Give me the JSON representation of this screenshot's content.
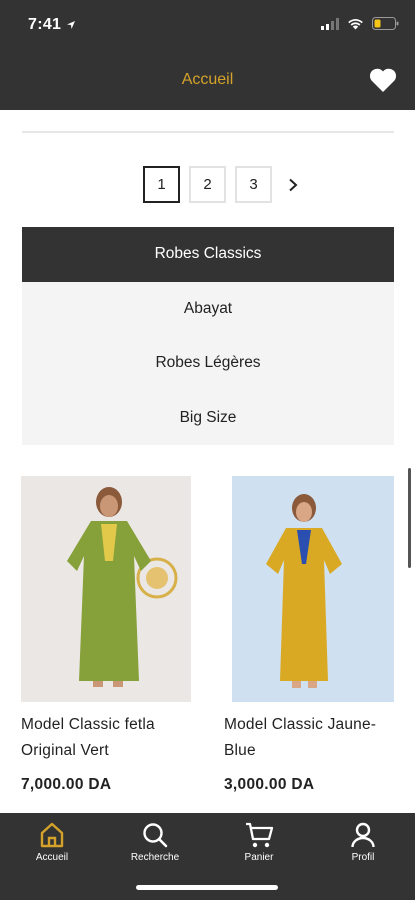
{
  "status_bar": {
    "time": "7:41"
  },
  "header": {
    "title": "Accueil",
    "favorites_icon": "heart-icon"
  },
  "pagination": {
    "pages": [
      "1",
      "2",
      "3"
    ],
    "current": "1",
    "next_icon": "chevron-right-icon"
  },
  "categories": [
    {
      "label": "Robes Classics",
      "active": true
    },
    {
      "label": "Abayat",
      "active": false
    },
    {
      "label": "Robes Légères",
      "active": false
    },
    {
      "label": "Big Size",
      "active": false
    }
  ],
  "products": [
    {
      "name": "Model Classic fetla Original Vert",
      "price": "7,000.00 DA",
      "image_bg": "#efeceb",
      "dress_color": "#86a03a"
    },
    {
      "name": "Model Classic Jaune-Blue",
      "price": "3,000.00 DA",
      "image_bg": "#cfe0f0",
      "dress_color": "#d9a923"
    }
  ],
  "tab_bar": {
    "accent": "#d4a22a",
    "tabs": [
      {
        "label": "Accueil",
        "icon": "home-icon",
        "active": true
      },
      {
        "label": "Recherche",
        "icon": "search-icon",
        "active": false
      },
      {
        "label": "Panier",
        "icon": "cart-icon",
        "active": false
      },
      {
        "label": "Profil",
        "icon": "user-icon",
        "active": false
      }
    ]
  }
}
